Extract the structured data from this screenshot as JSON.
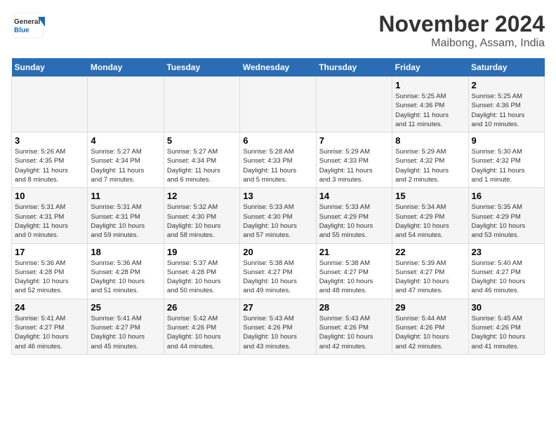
{
  "header": {
    "logo_general": "General",
    "logo_blue": "Blue",
    "title": "November 2024",
    "subtitle": "Maibong, Assam, India"
  },
  "weekdays": [
    "Sunday",
    "Monday",
    "Tuesday",
    "Wednesday",
    "Thursday",
    "Friday",
    "Saturday"
  ],
  "weeks": [
    [
      {
        "day": "",
        "info": ""
      },
      {
        "day": "",
        "info": ""
      },
      {
        "day": "",
        "info": ""
      },
      {
        "day": "",
        "info": ""
      },
      {
        "day": "",
        "info": ""
      },
      {
        "day": "1",
        "info": "Sunrise: 5:25 AM\nSunset: 4:36 PM\nDaylight: 11 hours\nand 11 minutes."
      },
      {
        "day": "2",
        "info": "Sunrise: 5:25 AM\nSunset: 4:36 PM\nDaylight: 11 hours\nand 10 minutes."
      }
    ],
    [
      {
        "day": "3",
        "info": "Sunrise: 5:26 AM\nSunset: 4:35 PM\nDaylight: 11 hours\nand 8 minutes."
      },
      {
        "day": "4",
        "info": "Sunrise: 5:27 AM\nSunset: 4:34 PM\nDaylight: 11 hours\nand 7 minutes."
      },
      {
        "day": "5",
        "info": "Sunrise: 5:27 AM\nSunset: 4:34 PM\nDaylight: 11 hours\nand 6 minutes."
      },
      {
        "day": "6",
        "info": "Sunrise: 5:28 AM\nSunset: 4:33 PM\nDaylight: 11 hours\nand 5 minutes."
      },
      {
        "day": "7",
        "info": "Sunrise: 5:29 AM\nSunset: 4:33 PM\nDaylight: 11 hours\nand 3 minutes."
      },
      {
        "day": "8",
        "info": "Sunrise: 5:29 AM\nSunset: 4:32 PM\nDaylight: 11 hours\nand 2 minutes."
      },
      {
        "day": "9",
        "info": "Sunrise: 5:30 AM\nSunset: 4:32 PM\nDaylight: 11 hours\nand 1 minute."
      }
    ],
    [
      {
        "day": "10",
        "info": "Sunrise: 5:31 AM\nSunset: 4:31 PM\nDaylight: 11 hours\nand 0 minutes."
      },
      {
        "day": "11",
        "info": "Sunrise: 5:31 AM\nSunset: 4:31 PM\nDaylight: 10 hours\nand 59 minutes."
      },
      {
        "day": "12",
        "info": "Sunrise: 5:32 AM\nSunset: 4:30 PM\nDaylight: 10 hours\nand 58 minutes."
      },
      {
        "day": "13",
        "info": "Sunrise: 5:33 AM\nSunset: 4:30 PM\nDaylight: 10 hours\nand 57 minutes."
      },
      {
        "day": "14",
        "info": "Sunrise: 5:33 AM\nSunset: 4:29 PM\nDaylight: 10 hours\nand 55 minutes."
      },
      {
        "day": "15",
        "info": "Sunrise: 5:34 AM\nSunset: 4:29 PM\nDaylight: 10 hours\nand 54 minutes."
      },
      {
        "day": "16",
        "info": "Sunrise: 5:35 AM\nSunset: 4:29 PM\nDaylight: 10 hours\nand 53 minutes."
      }
    ],
    [
      {
        "day": "17",
        "info": "Sunrise: 5:36 AM\nSunset: 4:28 PM\nDaylight: 10 hours\nand 52 minutes."
      },
      {
        "day": "18",
        "info": "Sunrise: 5:36 AM\nSunset: 4:28 PM\nDaylight: 10 hours\nand 51 minutes."
      },
      {
        "day": "19",
        "info": "Sunrise: 5:37 AM\nSunset: 4:28 PM\nDaylight: 10 hours\nand 50 minutes."
      },
      {
        "day": "20",
        "info": "Sunrise: 5:38 AM\nSunset: 4:27 PM\nDaylight: 10 hours\nand 49 minutes."
      },
      {
        "day": "21",
        "info": "Sunrise: 5:38 AM\nSunset: 4:27 PM\nDaylight: 10 hours\nand 48 minutes."
      },
      {
        "day": "22",
        "info": "Sunrise: 5:39 AM\nSunset: 4:27 PM\nDaylight: 10 hours\nand 47 minutes."
      },
      {
        "day": "23",
        "info": "Sunrise: 5:40 AM\nSunset: 4:27 PM\nDaylight: 10 hours\nand 46 minutes."
      }
    ],
    [
      {
        "day": "24",
        "info": "Sunrise: 5:41 AM\nSunset: 4:27 PM\nDaylight: 10 hours\nand 46 minutes."
      },
      {
        "day": "25",
        "info": "Sunrise: 5:41 AM\nSunset: 4:27 PM\nDaylight: 10 hours\nand 45 minutes."
      },
      {
        "day": "26",
        "info": "Sunrise: 5:42 AM\nSunset: 4:26 PM\nDaylight: 10 hours\nand 44 minutes."
      },
      {
        "day": "27",
        "info": "Sunrise: 5:43 AM\nSunset: 4:26 PM\nDaylight: 10 hours\nand 43 minutes."
      },
      {
        "day": "28",
        "info": "Sunrise: 5:43 AM\nSunset: 4:26 PM\nDaylight: 10 hours\nand 42 minutes."
      },
      {
        "day": "29",
        "info": "Sunrise: 5:44 AM\nSunset: 4:26 PM\nDaylight: 10 hours\nand 42 minutes."
      },
      {
        "day": "30",
        "info": "Sunrise: 5:45 AM\nSunset: 4:26 PM\nDaylight: 10 hours\nand 41 minutes."
      }
    ]
  ]
}
